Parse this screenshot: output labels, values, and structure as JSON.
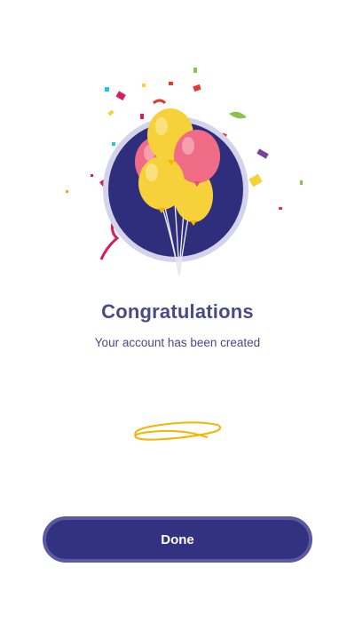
{
  "screen": {
    "title": "Congratulations",
    "subtitle": "Your account has been created",
    "done_label": "Done"
  },
  "icons": {
    "hero": "balloons-confetti-icon",
    "loader": "scribble-loader-icon"
  },
  "colors": {
    "primary": "#323280",
    "primary_border": "#5a5aa2",
    "text": "#4a4a86",
    "accent_yellow": "#f5b400",
    "balloon_pink": "#f06c86",
    "balloon_yellow": "#f7d13a",
    "background": "#ffffff"
  }
}
